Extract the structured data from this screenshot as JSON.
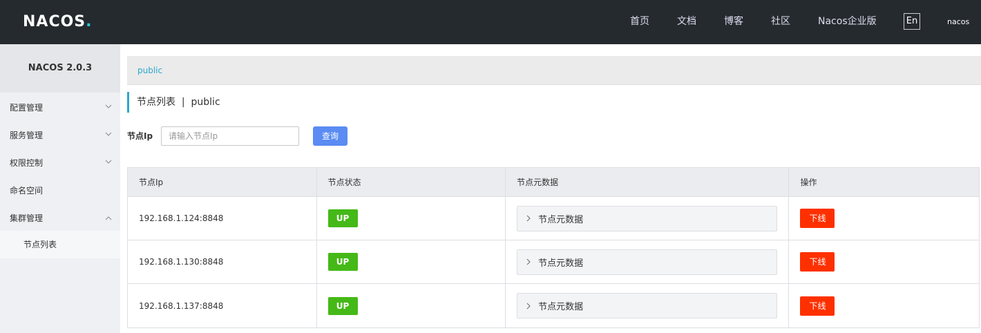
{
  "header": {
    "logo_text": "NACOS",
    "logo_dot": ".",
    "nav": [
      "首页",
      "文档",
      "博客",
      "社区",
      "Nacos企业版"
    ],
    "lang": "En",
    "user": "nacos"
  },
  "sidebar": {
    "title": "NACOS 2.0.3",
    "items": [
      {
        "label": "配置管理",
        "expanded": false
      },
      {
        "label": "服务管理",
        "expanded": false
      },
      {
        "label": "权限控制",
        "expanded": false
      },
      {
        "label": "命名空间"
      },
      {
        "label": "集群管理",
        "expanded": true
      }
    ],
    "sub_item": "节点列表"
  },
  "breadcrumb": "public",
  "page_title": "节点列表  |  public",
  "search": {
    "label": "节点Ip",
    "placeholder": "请输入节点Ip",
    "button": "查询"
  },
  "table": {
    "headers": [
      "节点Ip",
      "节点状态",
      "节点元数据",
      "操作"
    ],
    "rows": [
      {
        "ip": "192.168.1.124:8848",
        "status": "UP",
        "meta": "节点元数据",
        "action": "下线"
      },
      {
        "ip": "192.168.1.130:8848",
        "status": "UP",
        "meta": "节点元数据",
        "action": "下线"
      },
      {
        "ip": "192.168.1.137:8848",
        "status": "UP",
        "meta": "节点元数据",
        "action": "下线"
      }
    ]
  },
  "colors": {
    "topbar": "#252a2f",
    "accent": "#2ba8c9",
    "primary_button": "#5a8cf3",
    "status_up": "#45b917",
    "danger": "#ff3000"
  }
}
